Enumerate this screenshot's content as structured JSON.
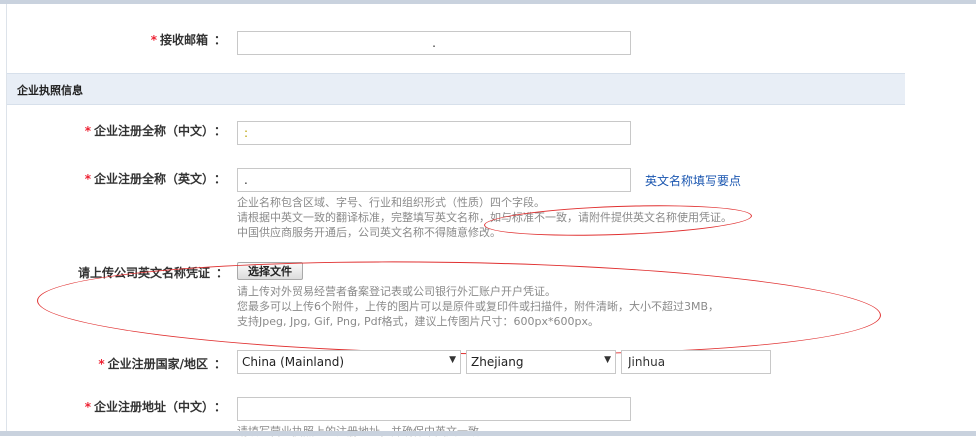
{
  "form": {
    "email_label": "接收邮箱",
    "email_value": ".",
    "section_title": "企业执照信息",
    "name_cn_label": "企业注册全称（中文）",
    "name_cn_value": ":",
    "name_en_label": "企业注册全称（英文）",
    "name_en_value": ".",
    "name_en_link": "英文名称填写要点",
    "name_en_hints": [
      "企业名称包含区域、字号、行业和组织形式（性质）四个字段。",
      "请根据中英文一致的翻译标准，完整填写英文名称，如与标准不一致，请附件提供英文名称使用凭证。",
      "中国供应商服务开通后，公司英文名称不得随意修改。"
    ],
    "upload_label": "请上传公司英文名称凭证",
    "upload_button": "选择文件",
    "upload_hints": [
      "请上传对外贸易经营者备案登记表或公司银行外汇账户开户凭证。",
      "您最多可以上传6个附件，上传的图片可以是原件或复印件或扫描件，附件清晰，大小不超过3MB，",
      "支持Jpeg, Jpg, Gif, Png, Pdf格式，建议上传图片尺寸：600px*600px。"
    ],
    "country_label": "企业注册国家/地区",
    "country_value": "China (Mainland)",
    "province_value": "Zhejiang",
    "city_value": "Jinhua",
    "address_cn_label": "企业注册地址（中文）",
    "address_cn_value": "",
    "address_hint": "请填写营业执照上的注册地址，并确保中英文一致"
  },
  "colors": {
    "required": "#e23333",
    "link": "#1a56b0",
    "annotation": "#e03030",
    "section_bg": "#e8eef6"
  }
}
